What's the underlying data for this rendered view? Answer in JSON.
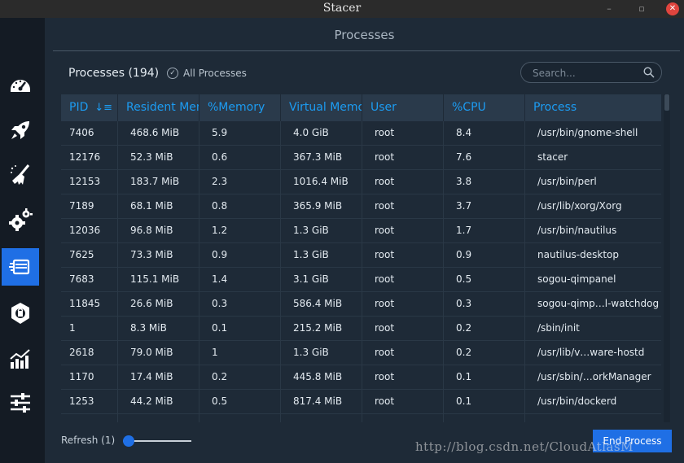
{
  "window": {
    "title": "Stacer",
    "minimize_glyph": "–",
    "maximize_glyph": "▫",
    "close_glyph": "✕"
  },
  "sidebar": {
    "items": [
      {
        "icon": "speedometer-icon",
        "active": false
      },
      {
        "icon": "rocket-icon",
        "active": false
      },
      {
        "icon": "broom-icon",
        "active": false
      },
      {
        "icon": "gears-icon",
        "active": false
      },
      {
        "icon": "processes-icon",
        "active": true
      },
      {
        "icon": "uninstaller-icon",
        "active": false
      },
      {
        "icon": "chart-icon",
        "active": false
      },
      {
        "icon": "sliders-icon",
        "active": false
      }
    ],
    "active_color": "#1f6fe5"
  },
  "page": {
    "title": "Processes",
    "count_label": "Processes (194)",
    "all_processes_label": "All Processes",
    "search_placeholder": "Search..."
  },
  "table": {
    "columns": [
      "PID",
      "Resident Memory",
      "%Memory",
      "Virtual Memory",
      "User",
      "%CPU",
      "Process"
    ],
    "sort_glyph": "↓≡",
    "rows": [
      [
        "7406",
        "468.6 MiB",
        "5.9",
        "4.0 GiB",
        "root",
        "8.4",
        "/usr/bin/gnome-shell"
      ],
      [
        "12176",
        "52.3 MiB",
        "0.6",
        "367.3 MiB",
        "root",
        "7.6",
        "stacer"
      ],
      [
        "12153",
        "183.7 MiB",
        "2.3",
        "1016.4 MiB",
        "root",
        "3.8",
        "/usr/bin/perl"
      ],
      [
        "7189",
        "68.1 MiB",
        "0.8",
        "365.9 MiB",
        "root",
        "3.7",
        "/usr/lib/xorg/Xorg"
      ],
      [
        "12036",
        "96.8 MiB",
        "1.2",
        "1.3 GiB",
        "root",
        "1.7",
        "/usr/bin/nautilus"
      ],
      [
        "7625",
        "73.3 MiB",
        "0.9",
        "1.3 GiB",
        "root",
        "0.9",
        "nautilus-desktop"
      ],
      [
        "7683",
        "115.1 MiB",
        "1.4",
        "3.1 GiB",
        "root",
        "0.5",
        "sogou-qimpanel"
      ],
      [
        "11845",
        "26.6 MiB",
        "0.3",
        "586.4 MiB",
        "root",
        "0.3",
        "sogou-qimp…l-watchdog"
      ],
      [
        "1",
        "8.3 MiB",
        "0.1",
        "215.2 MiB",
        "root",
        "0.2",
        "/sbin/init"
      ],
      [
        "2618",
        "79.0 MiB",
        "1",
        "1.3 GiB",
        "root",
        "0.2",
        "/usr/lib/v…ware-hostd"
      ],
      [
        "1170",
        "17.4 MiB",
        "0.2",
        "445.8 MiB",
        "root",
        "0.1",
        "/usr/sbin/…orkManager"
      ],
      [
        "1253",
        "44.2 MiB",
        "0.5",
        "817.4 MiB",
        "root",
        "0.1",
        "/usr/bin/dockerd"
      ],
      [
        "",
        "",
        "",
        "",
        "",
        "",
        ""
      ]
    ]
  },
  "footer": {
    "refresh_label": "Refresh (1)",
    "refresh_value": 1,
    "end_process_label": "End Process"
  },
  "watermark": "http://blog.csdn.net/CloudAtlasM",
  "colors": {
    "accent": "#1f6fe5",
    "header_text": "#1c9cf2",
    "background": "#1e2a37",
    "sidebar": "#141b24"
  }
}
